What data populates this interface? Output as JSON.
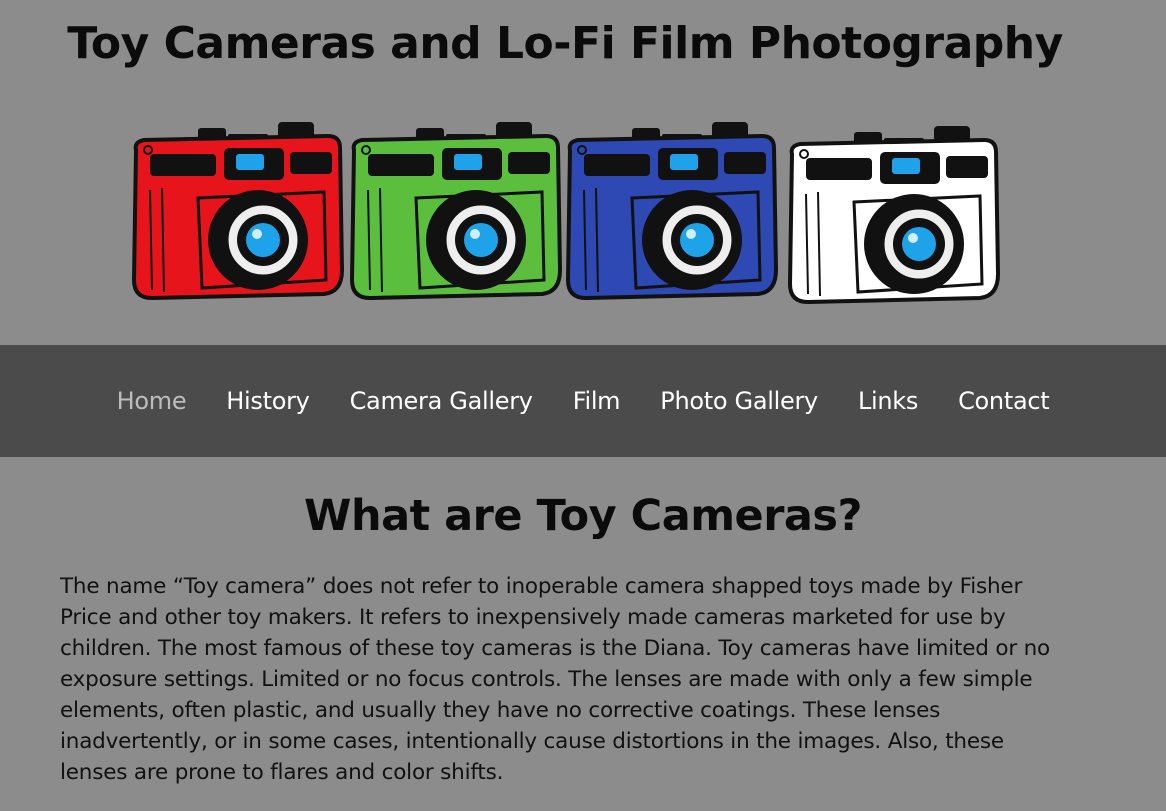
{
  "header": {
    "title": "Toy Cameras and Lo-Fi Film Photography",
    "banner_cameras": [
      {
        "icon": "red-toy-camera-icon",
        "color": "#e8141c"
      },
      {
        "icon": "green-toy-camera-icon",
        "color": "#5bbf3d"
      },
      {
        "icon": "blue-toy-camera-icon",
        "color": "#2e49b3"
      },
      {
        "icon": "white-toy-camera-icon",
        "color": "#ffffff"
      }
    ],
    "lens_color": "#1ea3ea"
  },
  "nav": {
    "items": [
      {
        "label": "Home",
        "active": true
      },
      {
        "label": "History"
      },
      {
        "label": "Camera Gallery"
      },
      {
        "label": "Film"
      },
      {
        "label": "Photo Gallery"
      },
      {
        "label": "Links"
      },
      {
        "label": "Contact"
      }
    ]
  },
  "main": {
    "heading": "What are Toy Cameras?",
    "paragraph": "The name “Toy camera” does not refer to inoperable camera shapped toys made by Fisher Price and other toy makers. It refers to inexpensively made cameras marketed for use by children. The most famous of these toy cameras is the Diana. Toy cameras have limited or no exposure settings. Limited or no focus controls. The lenses are made with only a few simple elements, often plastic, and usually they have no corrective coatings. These lenses inadvertently, or in some cases, intentionally cause distortions in the images. Also, these lenses are prone to flares and color shifts."
  },
  "theme": {
    "page_bg": "#8c8c8c",
    "nav_bg": "#4b4b4b",
    "nav_text": "#ffffff",
    "nav_active_text": "#bdbdbd"
  }
}
